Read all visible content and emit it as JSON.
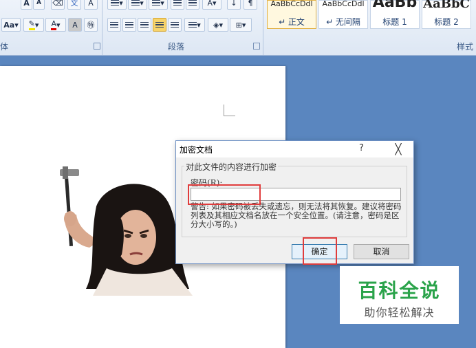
{
  "ribbon": {
    "font_group_label": "体",
    "paragraph_group_label": "段落",
    "styles_group_label": "样式",
    "font_buttons": [
      "A",
      "A",
      "Aa",
      "A"
    ],
    "styles": [
      {
        "preview": "AaBbCcDdl",
        "name": "↵ 正文",
        "active": true
      },
      {
        "preview": "AaBbCcDdl",
        "name": "↵ 无间隔",
        "active": false
      },
      {
        "preview": "AaBb",
        "name": "标题 1",
        "active": false
      },
      {
        "preview": "AaBbC",
        "name": "标题 2",
        "active": false
      }
    ],
    "colors": {
      "highlight": "#f3e600",
      "font_color": "#e00000"
    }
  },
  "dialog": {
    "title": "加密文档",
    "help": "?",
    "close": "╳",
    "section_label": "对此文件的内容进行加密",
    "password_label": "密码(R):",
    "password_value": "",
    "warning_text": "警告: 如果密码被丢失或遗忘，则无法将其恢复。建议将密码列表及其相应文档名放在一个安全位置。(请注意，密码是区分大小写的。)",
    "ok_label": "确定",
    "cancel_label": "取消"
  },
  "watermark": {
    "main": "百科全说",
    "sub": "助你轻松解决",
    "color": "#2aa34a"
  },
  "highlight_color": "#e03c3c"
}
